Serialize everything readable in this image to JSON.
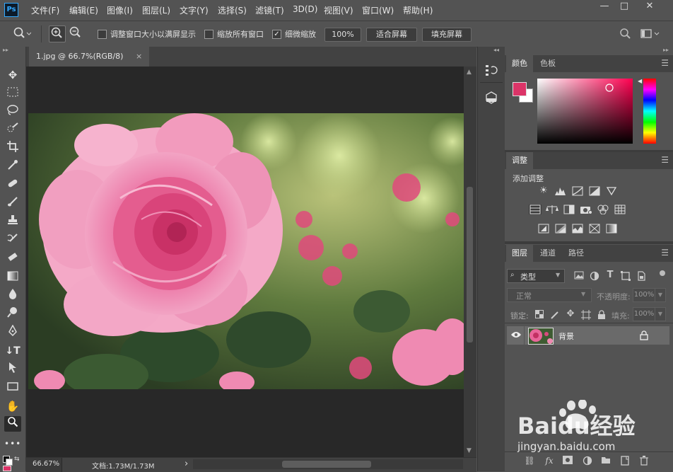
{
  "app": {
    "logo": "Ps"
  },
  "menu": [
    "文件(F)",
    "编辑(E)",
    "图像(I)",
    "图层(L)",
    "文字(Y)",
    "选择(S)",
    "滤镜(T)",
    "3D(D)",
    "视图(V)",
    "窗口(W)",
    "帮助(H)"
  ],
  "window_controls": {
    "minimize": "—",
    "maximize": "□",
    "close": "✕"
  },
  "options": {
    "resize_window_label": "调整窗口大小以满屏显示",
    "zoom_all_label": "缩放所有窗口",
    "scrubby_label": "细微缩放",
    "scrubby_checked": true,
    "zoom_value": "100%",
    "fit_screen_label": "适合屏幕",
    "fill_screen_label": "填充屏幕"
  },
  "document": {
    "tab_label": "1.jpg @ 66.7%(RGB/8)",
    "tab_close": "×",
    "zoom": "66.67%",
    "doc_info": "文档:1.73M/1.73M",
    "status_arrow": "›"
  },
  "color_panel": {
    "tabs": [
      "颜色",
      "色板"
    ],
    "foreground": "#dc3468",
    "background": "#ffffff"
  },
  "adjustments_panel": {
    "tab": "调整",
    "add_label": "添加调整"
  },
  "layers_panel": {
    "tabs": [
      "图层",
      "通道",
      "路径"
    ],
    "filter_label": "类型",
    "blend_mode": "正常",
    "opacity_label": "不透明度:",
    "opacity_value": "100%",
    "lock_label": "锁定:",
    "fill_label": "填充:",
    "fill_value": "100%",
    "layers": [
      {
        "name": "背景",
        "visible": true,
        "locked": true
      }
    ]
  },
  "watermark": {
    "brand": "Baidu经验",
    "url": "jingyan.baidu.com"
  }
}
